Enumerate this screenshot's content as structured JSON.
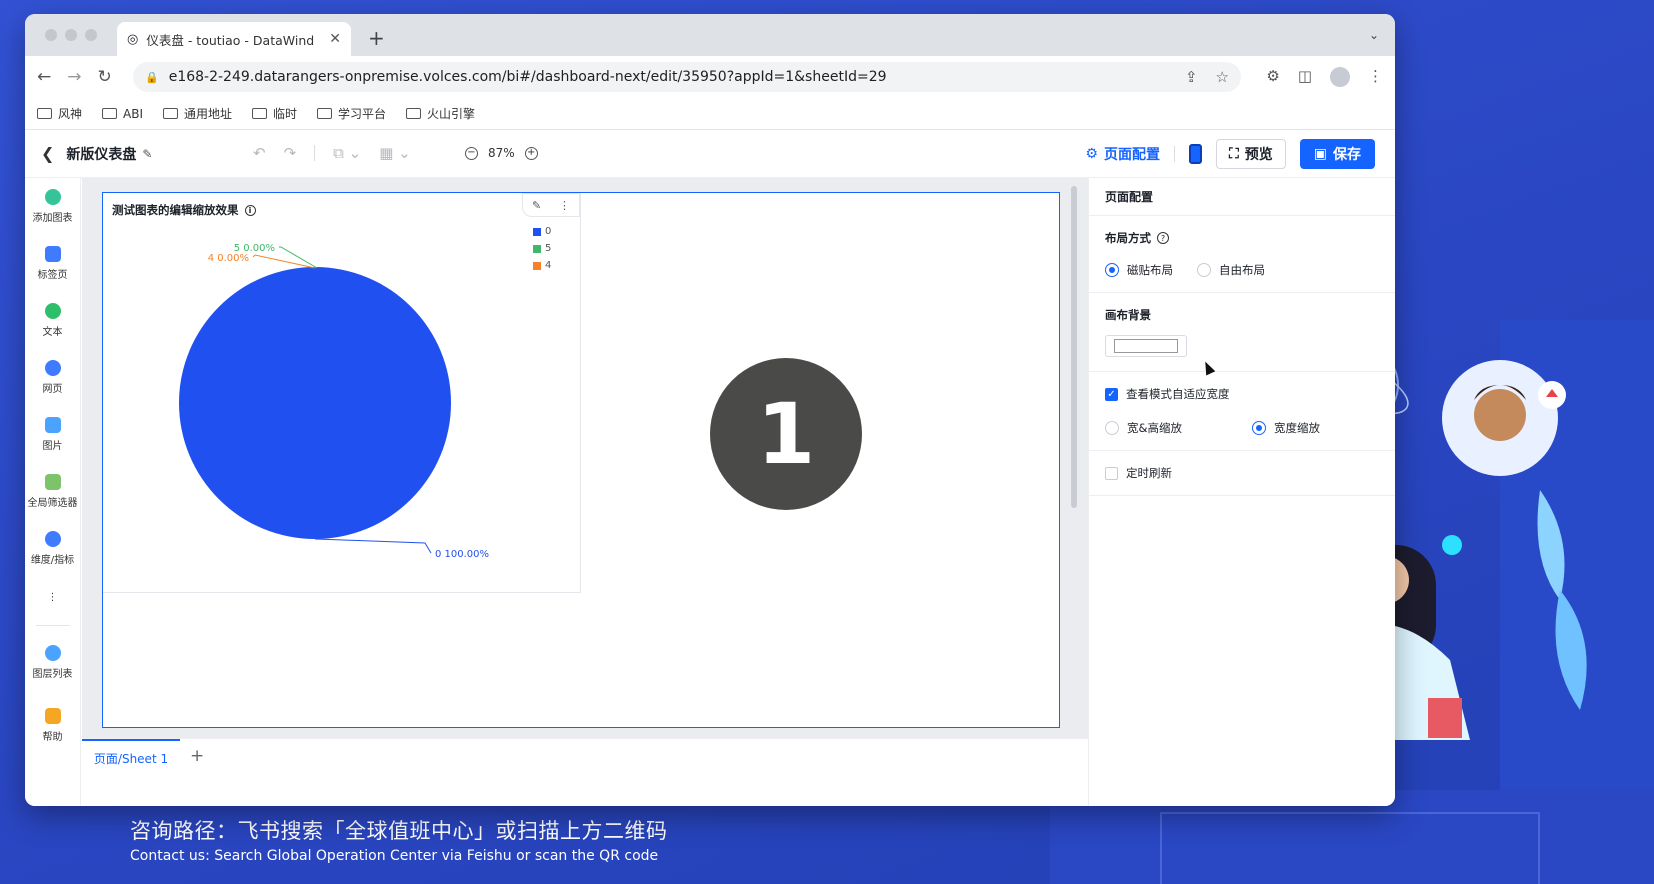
{
  "browser": {
    "tab_title": "仪表盘 - toutiao - DataWind",
    "url": "e168-2-249.datarangers-onpremise.volces.com/bi#/dashboard-next/edit/35950?appId=1&sheetId=29",
    "bookmarks": [
      "风神",
      "ABI",
      "通用地址",
      "临时",
      "学习平台",
      "火山引擎"
    ]
  },
  "header": {
    "title": "新版仪表盘",
    "zoom": "87%",
    "page_config": "页面配置",
    "preview": "预览",
    "save": "保存"
  },
  "left_toolbar": [
    "添加图表",
    "标签页",
    "文本",
    "网页",
    "图片",
    "全局筛选器",
    "维度/指标",
    "图层列表",
    "帮助"
  ],
  "chart_card": {
    "title": "测试图表的编辑缩放效果"
  },
  "chart_data": {
    "type": "pie",
    "slices": [
      {
        "label": "0",
        "value": 100.0,
        "text": "0  100.00%",
        "color": "#2150f0"
      },
      {
        "label": "5",
        "value": 0.0,
        "text": "5  0.00%",
        "color": "#3fb86b"
      },
      {
        "label": "4",
        "value": 0.0,
        "text": "4  0.00%",
        "color": "#f5822a"
      }
    ],
    "legend": [
      "0",
      "5",
      "4"
    ],
    "legend_colors": [
      "#2150f0",
      "#3fb86b",
      "#f5822a"
    ]
  },
  "overlay_number": "1",
  "sheet_tab": "页面/Sheet 1",
  "right_panel": {
    "title": "页面配置",
    "layout_label": "布局方式",
    "layout_options": [
      "磁贴布局",
      "自由布局"
    ],
    "bg_label": "画布背景",
    "adaptive_label": "查看模式自适应宽度",
    "scale_options": [
      "宽&高缩放",
      "宽度缩放"
    ],
    "refresh_label": "定时刷新"
  },
  "footer": {
    "cn": "咨询路径：飞书搜索「全球值班中心」或扫描上方二维码",
    "en": "Contact us: Search Global Operation Center via Feishu or scan the QR code"
  }
}
